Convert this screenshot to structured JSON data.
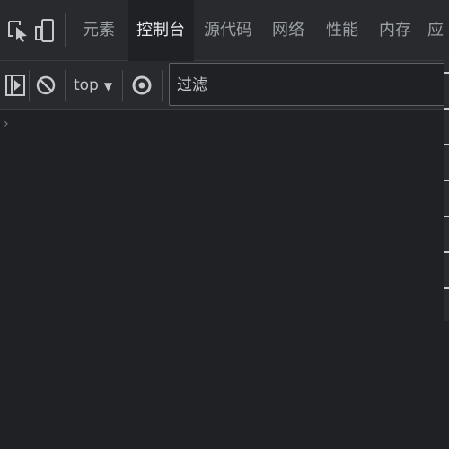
{
  "tabs": [
    {
      "label": "元素",
      "active": false
    },
    {
      "label": "控制台",
      "active": true
    },
    {
      "label": "源代码",
      "active": false
    },
    {
      "label": "网络",
      "active": false
    },
    {
      "label": "性能",
      "active": false
    },
    {
      "label": "内存",
      "active": false
    },
    {
      "label": "应",
      "active": false
    }
  ],
  "toolbar": {
    "context_label": "top",
    "filter_placeholder": "过滤"
  },
  "icons": {
    "inspect": "inspect-element-icon",
    "device": "device-toolbar-icon",
    "sidebar": "sidebar-toggle-icon",
    "clear": "clear-console-icon",
    "dropdown": "chevron-down-icon",
    "live_expression": "eye-icon",
    "prompt": "chevron-right-icon"
  },
  "colors": {
    "background": "#202124",
    "toolbar": "#292a2d",
    "text": "#e8eaed",
    "muted": "#9aa0a6"
  }
}
